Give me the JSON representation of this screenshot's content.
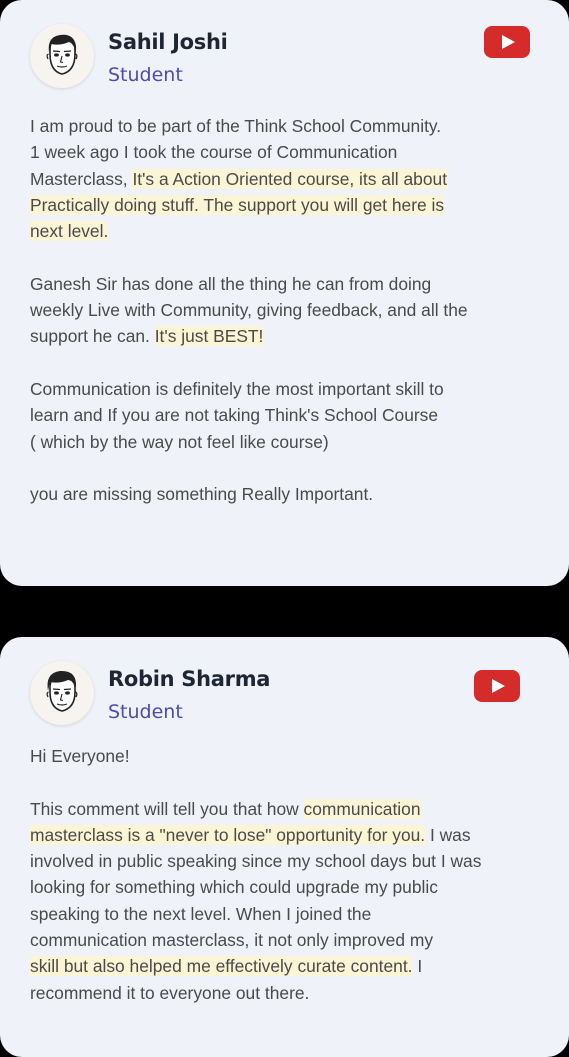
{
  "colors": {
    "card_background": "#eff2f8",
    "page_background": "#000000",
    "role_text": "#4d4da8",
    "highlight": "#fbf5d6",
    "youtube_red": "#d52b2b"
  },
  "testimonials": [
    {
      "name": "Sahil Joshi",
      "role": "Student",
      "avatar_icon": "cartoon-face-icon",
      "badge_icon": "youtube-icon",
      "lines": [
        "I am proud to be part of the Think School Community.",
        "1 week ago I took the course of Communication",
        "Masterclass, ",
        "It's a Action Oriented course, its all about",
        "Practically doing stuff. The support you will get here is",
        "next level.",
        "Ganesh Sir has done all the thing he can from doing",
        "weekly Live  with Community, giving feedback, and all the",
        "support he can. ",
        "It's just BEST!",
        "Communication is definitely the most important skill to",
        "learn and If you are not taking Think's School Course",
        "( which by the way not feel like course)",
        "you are missing something Really Important."
      ]
    },
    {
      "name": "Robin Sharma",
      "role": "Student",
      "avatar_icon": "cartoon-face-icon",
      "badge_icon": "youtube-icon",
      "lines": [
        "Hi Everyone!",
        "This comment will tell you that how ",
        "communication",
        "masterclass is a \"never to lose\" opportunity for you.",
        " I was",
        "involved in public speaking since my school days but I was",
        "looking for something which could upgrade my public",
        "speaking to the next level. When I joined the",
        "communication masterclass, it not only improved my",
        "skill but also helped me effectively curate content.",
        " I",
        "recommend it to everyone out there."
      ]
    }
  ]
}
